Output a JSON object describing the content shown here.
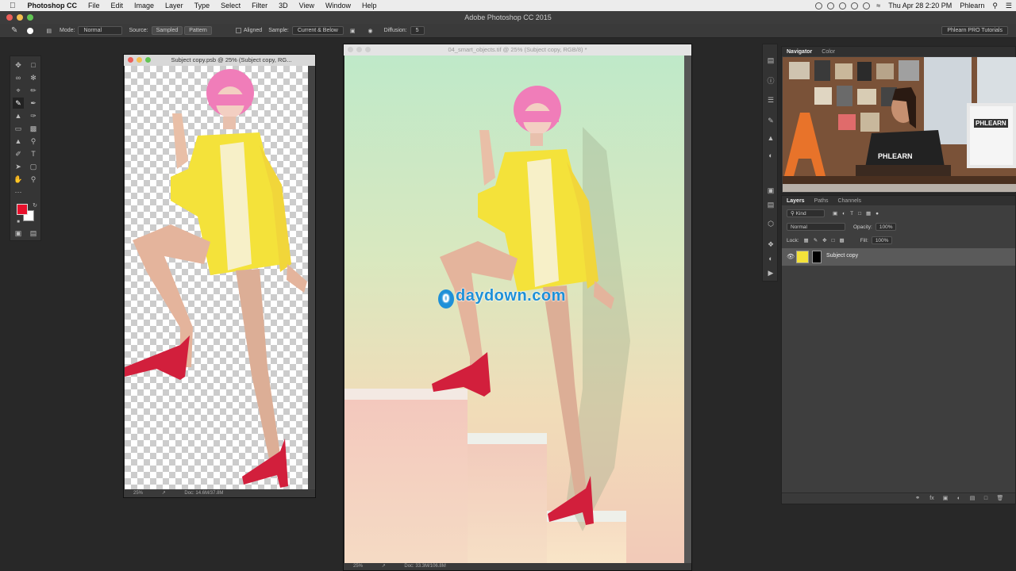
{
  "menubar": {
    "app": "Photoshop CC",
    "items": [
      "File",
      "Edit",
      "Image",
      "Layer",
      "Type",
      "Select",
      "Filter",
      "3D",
      "View",
      "Window",
      "Help"
    ],
    "clock": "Thu Apr 28  2:20 PM",
    "user": "Phlearn"
  },
  "window_title": "Adobe Photoshop CC 2015",
  "options": {
    "mode_label": "Mode:",
    "mode_value": "Normal",
    "source_label": "Source:",
    "source_sampled": "Sampled",
    "source_pattern": "Pattern",
    "aligned_label": "Aligned",
    "sample_label": "Sample:",
    "sample_value": "Current & Below",
    "diffusion_label": "Diffusion:",
    "diffusion_value": "5",
    "workspace": "Phlearn PRO Tutorials"
  },
  "colors": {
    "foreground": "#e8102c",
    "background": "#ffffff"
  },
  "doc1": {
    "title": "Subject copy.psb @ 25% (Subject copy, RG...",
    "zoom": "25%",
    "doc_size": "Doc: 14.6M/37.8M"
  },
  "doc2": {
    "title": "04_smart_objects.tif @ 25% (Subject copy, RGB/8) *",
    "zoom": "25%",
    "doc_size": "Doc: 33.3M/106.8M"
  },
  "watermark": {
    "text": "daydown.com",
    "badge": "0"
  },
  "navigator": {
    "tab_navigator": "Navigator",
    "tab_color": "Color",
    "shirt_text": "PHLEARN",
    "monitor_text": "PHLEARN"
  },
  "layers": {
    "tabs": [
      "Layers",
      "Paths",
      "Channels"
    ],
    "filter_kind": "Kind",
    "blend_mode": "Normal",
    "opacity_label": "Opacity:",
    "opacity_value": "100%",
    "lock_label": "Lock:",
    "fill_label": "Fill:",
    "fill_value": "100%",
    "layer_name": "Subject copy"
  }
}
